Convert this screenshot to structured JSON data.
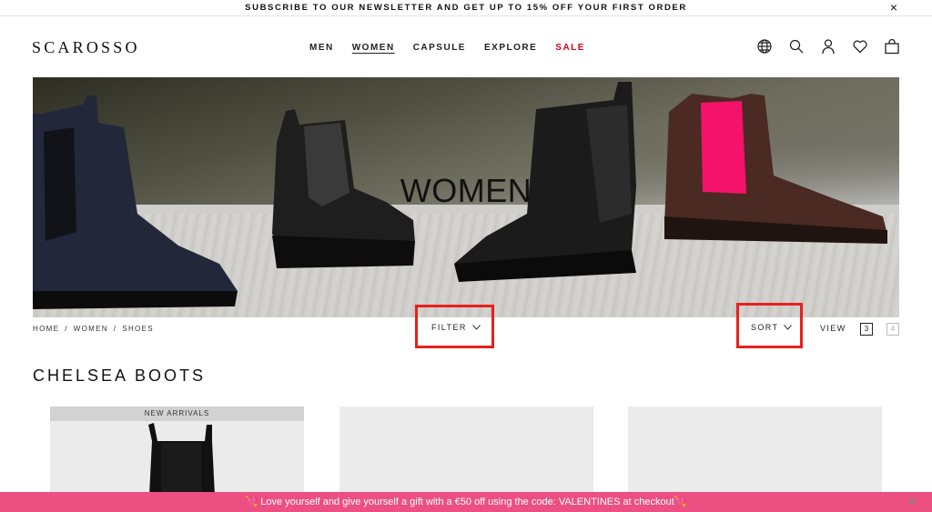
{
  "announcement": {
    "text": "SUBSCRIBE TO OUR NEWSLETTER AND GET UP TO 15% OFF YOUR FIRST ORDER",
    "close": "×"
  },
  "header": {
    "logo": "SCAROSSO",
    "nav": [
      {
        "label": "MEN",
        "active": false
      },
      {
        "label": "WOMEN",
        "active": true
      },
      {
        "label": "CAPSULE",
        "active": false
      },
      {
        "label": "EXPLORE",
        "active": false
      },
      {
        "label": "SALE",
        "active": false,
        "color": "#e0001a"
      }
    ],
    "icons": [
      "globe-icon",
      "search-icon",
      "account-icon",
      "heart-icon",
      "bag-icon"
    ]
  },
  "hero": {
    "title": "WOMEN"
  },
  "toolbar": {
    "breadcrumb": [
      "HOME",
      "WOMEN",
      "SHOES"
    ],
    "breadcrumb_sep": "/",
    "filter_label": "FILTER",
    "sort_label": "SORT",
    "view_label": "VIEW",
    "view_options": [
      "3",
      "4"
    ],
    "view_selected": "3"
  },
  "section": {
    "title": "CHELSEA BOOTS"
  },
  "products": [
    {
      "badge": "NEW ARRIVALS"
    },
    {
      "badge": ""
    },
    {
      "badge": ""
    }
  ],
  "promo": {
    "text": "💘 Love yourself and give yourself a gift with a €50 off using the code: VALENTINES at checkout💘",
    "close": "✕",
    "color": "#ec4f82"
  },
  "colors": {
    "highlight": "#e8201b",
    "sale": "#e0001a"
  }
}
